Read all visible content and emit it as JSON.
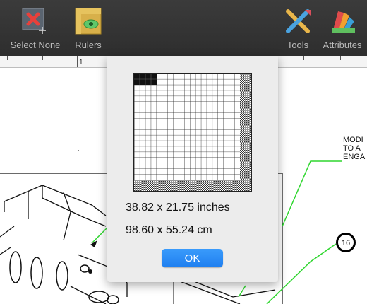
{
  "toolbar": {
    "select_none_label": "Select None",
    "rulers_label": "Rulers",
    "tools_label": "Tools",
    "attributes_label": "Attributes"
  },
  "ruler": {
    "marker": "1"
  },
  "drawing": {
    "note_text": "MODI\nTO A\nENGA",
    "callout_number": "16"
  },
  "popover": {
    "size_inches": "38.82 x 21.75 inches",
    "size_cm": "98.60 x 55.24 cm",
    "ok_label": "OK"
  },
  "colors": {
    "toolbar_bg": "#333333",
    "ok_button": "#2a8cf7",
    "leader_line": "#2fd62f"
  }
}
